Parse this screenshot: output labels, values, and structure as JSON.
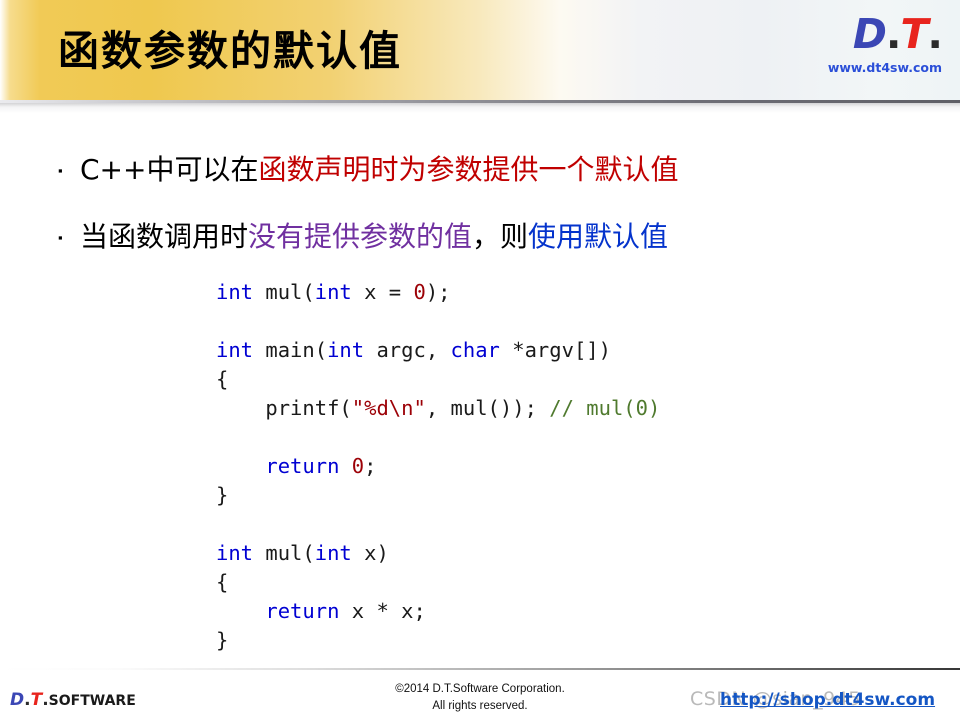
{
  "header": {
    "title": "函数参数的默认值",
    "logo": {
      "d": "D",
      "dot1": ".",
      "t": "T",
      "dot2": ".",
      "url": "www.dt4sw.com"
    }
  },
  "bullets": [
    {
      "marker": "▪",
      "segments": [
        {
          "text": "C++中可以在",
          "color_class": "txt-black",
          "color": "#000000"
        },
        {
          "text": "函数声明时为参数提供一个默认值",
          "color_class": "txt-red",
          "color": "#c00000"
        }
      ]
    },
    {
      "marker": "▪",
      "segments": [
        {
          "text": "当函数调用时",
          "color_class": "txt-black",
          "color": "#000000"
        },
        {
          "text": "没有提供参数的值",
          "color_class": "txt-purple",
          "color": "#7030a0"
        },
        {
          "text": "，则",
          "color_class": "txt-black",
          "color": "#000000"
        },
        {
          "text": "使用默认值",
          "color_class": "txt-blue",
          "color": "#0433cc"
        }
      ]
    }
  ],
  "code": {
    "language": "c",
    "lines": [
      [
        {
          "t": "int",
          "c": "kw"
        },
        {
          "t": " mul(",
          "c": "pl"
        },
        {
          "t": "int",
          "c": "kw"
        },
        {
          "t": " x = ",
          "c": "pl"
        },
        {
          "t": "0",
          "c": "num"
        },
        {
          "t": ");",
          "c": "pl"
        }
      ],
      [
        {
          "t": "",
          "c": "pl"
        }
      ],
      [
        {
          "t": "int",
          "c": "kw"
        },
        {
          "t": " main(",
          "c": "pl"
        },
        {
          "t": "int",
          "c": "kw"
        },
        {
          "t": " argc, ",
          "c": "pl"
        },
        {
          "t": "char",
          "c": "kw"
        },
        {
          "t": " *argv[])",
          "c": "pl"
        }
      ],
      [
        {
          "t": "{",
          "c": "pl"
        }
      ],
      [
        {
          "t": "    printf(",
          "c": "pl"
        },
        {
          "t": "\"%d\\n\"",
          "c": "str"
        },
        {
          "t": ", mul()); ",
          "c": "pl"
        },
        {
          "t": "// mul(0)",
          "c": "com"
        }
      ],
      [
        {
          "t": "",
          "c": "pl"
        }
      ],
      [
        {
          "t": "    ",
          "c": "pl"
        },
        {
          "t": "return",
          "c": "kw"
        },
        {
          "t": " ",
          "c": "pl"
        },
        {
          "t": "0",
          "c": "num"
        },
        {
          "t": ";",
          "c": "pl"
        }
      ],
      [
        {
          "t": "}",
          "c": "pl"
        }
      ],
      [
        {
          "t": "",
          "c": "pl"
        }
      ],
      [
        {
          "t": "int",
          "c": "kw"
        },
        {
          "t": " mul(",
          "c": "pl"
        },
        {
          "t": "int",
          "c": "kw"
        },
        {
          "t": " x)",
          "c": "pl"
        }
      ],
      [
        {
          "t": "{",
          "c": "pl"
        }
      ],
      [
        {
          "t": "    ",
          "c": "pl"
        },
        {
          "t": "return",
          "c": "kw"
        },
        {
          "t": " x * x;",
          "c": "pl"
        }
      ],
      [
        {
          "t": "}",
          "c": "pl"
        }
      ]
    ]
  },
  "footer": {
    "logo": {
      "d": "D",
      "dot1": ".",
      "t": "T",
      "dot2": ".",
      "software": "SOFTWARE"
    },
    "copyright_line1": "©2014 D.T.Software Corporation.",
    "copyright_line2": "All rights reserved.",
    "watermark": "CSDN @sian_945",
    "link": "http://shop.dt4sw.com"
  },
  "colors": {
    "header_gradient_start": "#efc84e",
    "header_gradient_end": "#eef4f6",
    "accent_red": "#c00000",
    "accent_purple": "#7030a0",
    "accent_blue": "#0433cc",
    "logo_blue": "#3b47b5",
    "logo_red": "#e8241d",
    "code_keyword": "#0000d2",
    "code_number": "#9c0006",
    "code_string": "#9c0006",
    "code_comment": "#4f7a2e",
    "link_blue": "#1456c4"
  }
}
